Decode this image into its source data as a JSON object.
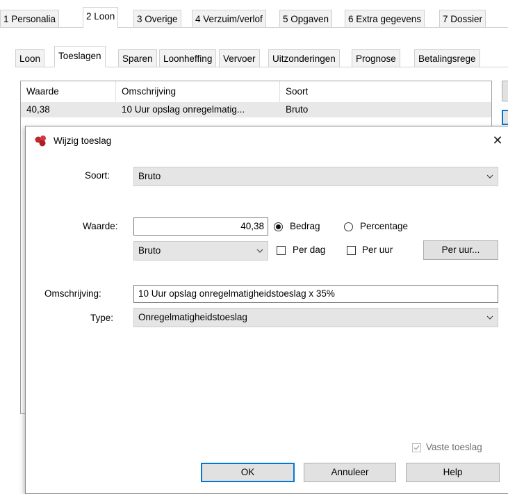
{
  "top_tabs": [
    "1 Personalia",
    "2 Loon",
    "3 Overige",
    "4 Verzuim/verlof",
    "5 Opgaven",
    "6 Extra gegevens",
    "7 Dossier"
  ],
  "sub_tabs": [
    "Loon",
    "Toeslagen",
    "Sparen",
    "Loonheffing",
    "Vervoer",
    "Uitzonderingen",
    "Prognose",
    "Betalingsrege"
  ],
  "grid": {
    "headers": [
      "Waarde",
      "Omschrijving",
      "Soort"
    ],
    "rows": [
      [
        "40,38",
        "10 Uur opslag onregelmatig...",
        "Bruto"
      ]
    ]
  },
  "dialog": {
    "title": "Wijzig toeslag",
    "close_glyph": "✕",
    "soort_label": "Soort:",
    "soort_value": "Bruto",
    "waarde_label": "Waarde:",
    "waarde_value": "40,38",
    "radio_bedrag": "Bedrag",
    "radio_percentage": "Percentage",
    "selected_radio": "Bedrag",
    "bruto_select": "Bruto",
    "check_per_dag": "Per dag",
    "check_per_uur": "Per uur",
    "per_uur_button": "Per uur...",
    "omschrijving_label": "Omschrijving:",
    "omschrijving_value": "10 Uur opslag onregelmatigheidstoeslag x 35%",
    "type_label": "Type:",
    "type_value": "Onregelmatigheidstoeslag",
    "vaste_toeslag_label": "Vaste toeslag",
    "vaste_toeslag_checked": true,
    "ok_label": "OK",
    "annuleer_label": "Annuleer",
    "help_label": "Help"
  },
  "colors": {
    "accent": "#0078d7",
    "icon_red": "#c0282d"
  }
}
